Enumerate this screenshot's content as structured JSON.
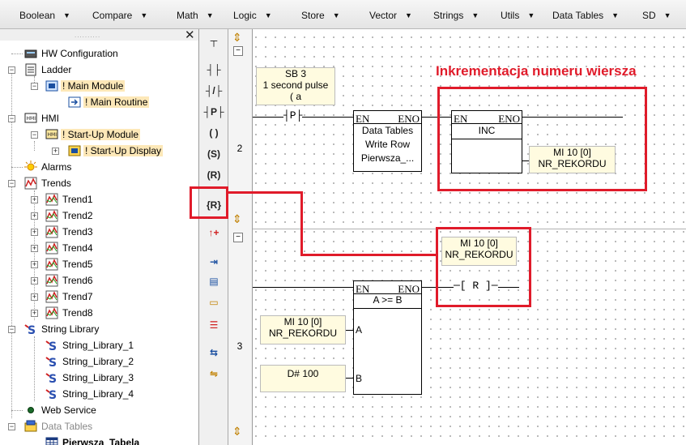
{
  "menubar": {
    "items": [
      "Boolean",
      "Compare",
      "Math",
      "Logic",
      "Store",
      "Vector",
      "Strings",
      "Utils",
      "Data Tables",
      "SD"
    ]
  },
  "tree": {
    "close_glyph": "✕",
    "items": [
      {
        "label": "HW Configuration",
        "icon": "hw-config-icon"
      },
      {
        "label": "Ladder",
        "icon": "ladder-icon"
      },
      {
        "label": "! Main Module",
        "icon": "module-icon"
      },
      {
        "label": "! Main Routine",
        "icon": "routine-icon"
      },
      {
        "label": "HMI",
        "icon": "hmi-icon"
      },
      {
        "label": "! Start-Up Module",
        "icon": "hmi-module-icon"
      },
      {
        "label": "! Start-Up Display",
        "icon": "display-icon"
      },
      {
        "label": "Alarms",
        "icon": "alarm-icon"
      },
      {
        "label": "Trends",
        "icon": "trends-icon"
      },
      {
        "label": "Trend1",
        "icon": "trend-icon"
      },
      {
        "label": "Trend2",
        "icon": "trend-icon"
      },
      {
        "label": "Trend3",
        "icon": "trend-icon"
      },
      {
        "label": "Trend4",
        "icon": "trend-icon"
      },
      {
        "label": "Trend5",
        "icon": "trend-icon"
      },
      {
        "label": "Trend6",
        "icon": "trend-icon"
      },
      {
        "label": "Trend7",
        "icon": "trend-icon"
      },
      {
        "label": "Trend8",
        "icon": "trend-icon"
      },
      {
        "label": "String Library",
        "icon": "string-library-icon"
      },
      {
        "label": "String_Library_1",
        "icon": "string-icon"
      },
      {
        "label": "String_Library_2",
        "icon": "string-icon"
      },
      {
        "label": "String_Library_3",
        "icon": "string-icon"
      },
      {
        "label": "String_Library_4",
        "icon": "string-icon"
      },
      {
        "label": "Web Service",
        "icon": "web-service-icon"
      },
      {
        "label": "Data Tables",
        "icon": "data-tables-icon"
      },
      {
        "label": "Pierwsza_Tabela",
        "icon": "table-icon"
      }
    ]
  },
  "toolbox": {
    "tools": [
      {
        "glyph": "┬",
        "icon": "top-wire-icon"
      },
      {
        "glyph": "┤├",
        "icon": "contact-no-icon"
      },
      {
        "glyph": "┤/├",
        "icon": "contact-nc-icon"
      },
      {
        "glyph": "┤P├",
        "icon": "contact-positive-icon"
      },
      {
        "glyph": "( )",
        "icon": "coil-icon"
      },
      {
        "glyph": "(S)",
        "icon": "set-coil-icon"
      },
      {
        "glyph": "(R)",
        "icon": "reset-coil-icon"
      },
      {
        "glyph": "{R}",
        "icon": "reset-tool-icon"
      },
      {
        "glyph": "↑+",
        "icon": "increment-tool-icon"
      },
      {
        "glyph": "⇥",
        "icon": "jump-icon"
      },
      {
        "glyph": "▤",
        "icon": "block-icon"
      },
      {
        "glyph": "▭",
        "icon": "comment-icon"
      },
      {
        "glyph": "☰",
        "icon": "list-icon"
      },
      {
        "glyph": "⇆",
        "icon": "call-icon"
      },
      {
        "glyph": "⇋",
        "icon": "subroutine-icon"
      }
    ]
  },
  "annotation": "Inkrementacja numeru wiersza",
  "rung2": {
    "number": "2",
    "collapse": "−",
    "contact_op": {
      "line1": "SB 3",
      "line2": "1 second pulse",
      "line3": "( a"
    },
    "contact_glyph": "┤P├",
    "write_block": {
      "en": "EN",
      "eno": "ENO",
      "line1": "Data Tables",
      "line2": "Write Row",
      "line3": "Pierwsza_..."
    },
    "inc_block": {
      "en": "EN",
      "eno": "ENO",
      "title": "INC"
    },
    "inc_op": {
      "line1": "MI 10 [0]",
      "line2": "NR_REKORDU"
    }
  },
  "rung3": {
    "number": "3",
    "collapse": "−",
    "coil_op": {
      "line1": "MI 10 [0]",
      "line2": "NR_REKORDU"
    },
    "coil_glyph": "─[ R ]─",
    "cmp_block": {
      "en": "EN",
      "eno": "ENO",
      "title": "A >= B",
      "pin_a": "A",
      "pin_b": "B"
    },
    "op_a": {
      "line1": "MI 10 [0]",
      "line2": "NR_REKORDU"
    },
    "op_b": {
      "line1": "D# 100"
    }
  }
}
